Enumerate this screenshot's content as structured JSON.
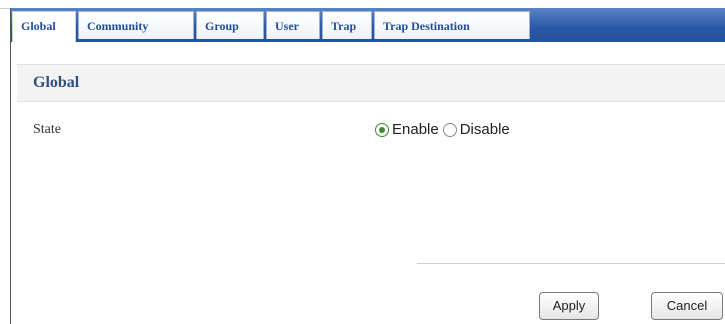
{
  "tabs": [
    {
      "label": "Global",
      "active": true
    },
    {
      "label": "Community",
      "active": false
    },
    {
      "label": "Group",
      "active": false
    },
    {
      "label": "User",
      "active": false
    },
    {
      "label": "Trap",
      "active": false
    },
    {
      "label": "Trap Destination",
      "active": false
    }
  ],
  "section": {
    "title": "Global"
  },
  "state": {
    "label": "State",
    "options": [
      {
        "label": "Enable",
        "selected": true
      },
      {
        "label": "Disable",
        "selected": false
      }
    ]
  },
  "buttons": {
    "apply": "Apply",
    "cancel": "Cancel"
  },
  "colors": {
    "tabbar": "#2c5aa8",
    "tab_text": "#1f4f9c",
    "section_title": "#2f4f7f",
    "radio_selected": "#3a8a3a"
  }
}
